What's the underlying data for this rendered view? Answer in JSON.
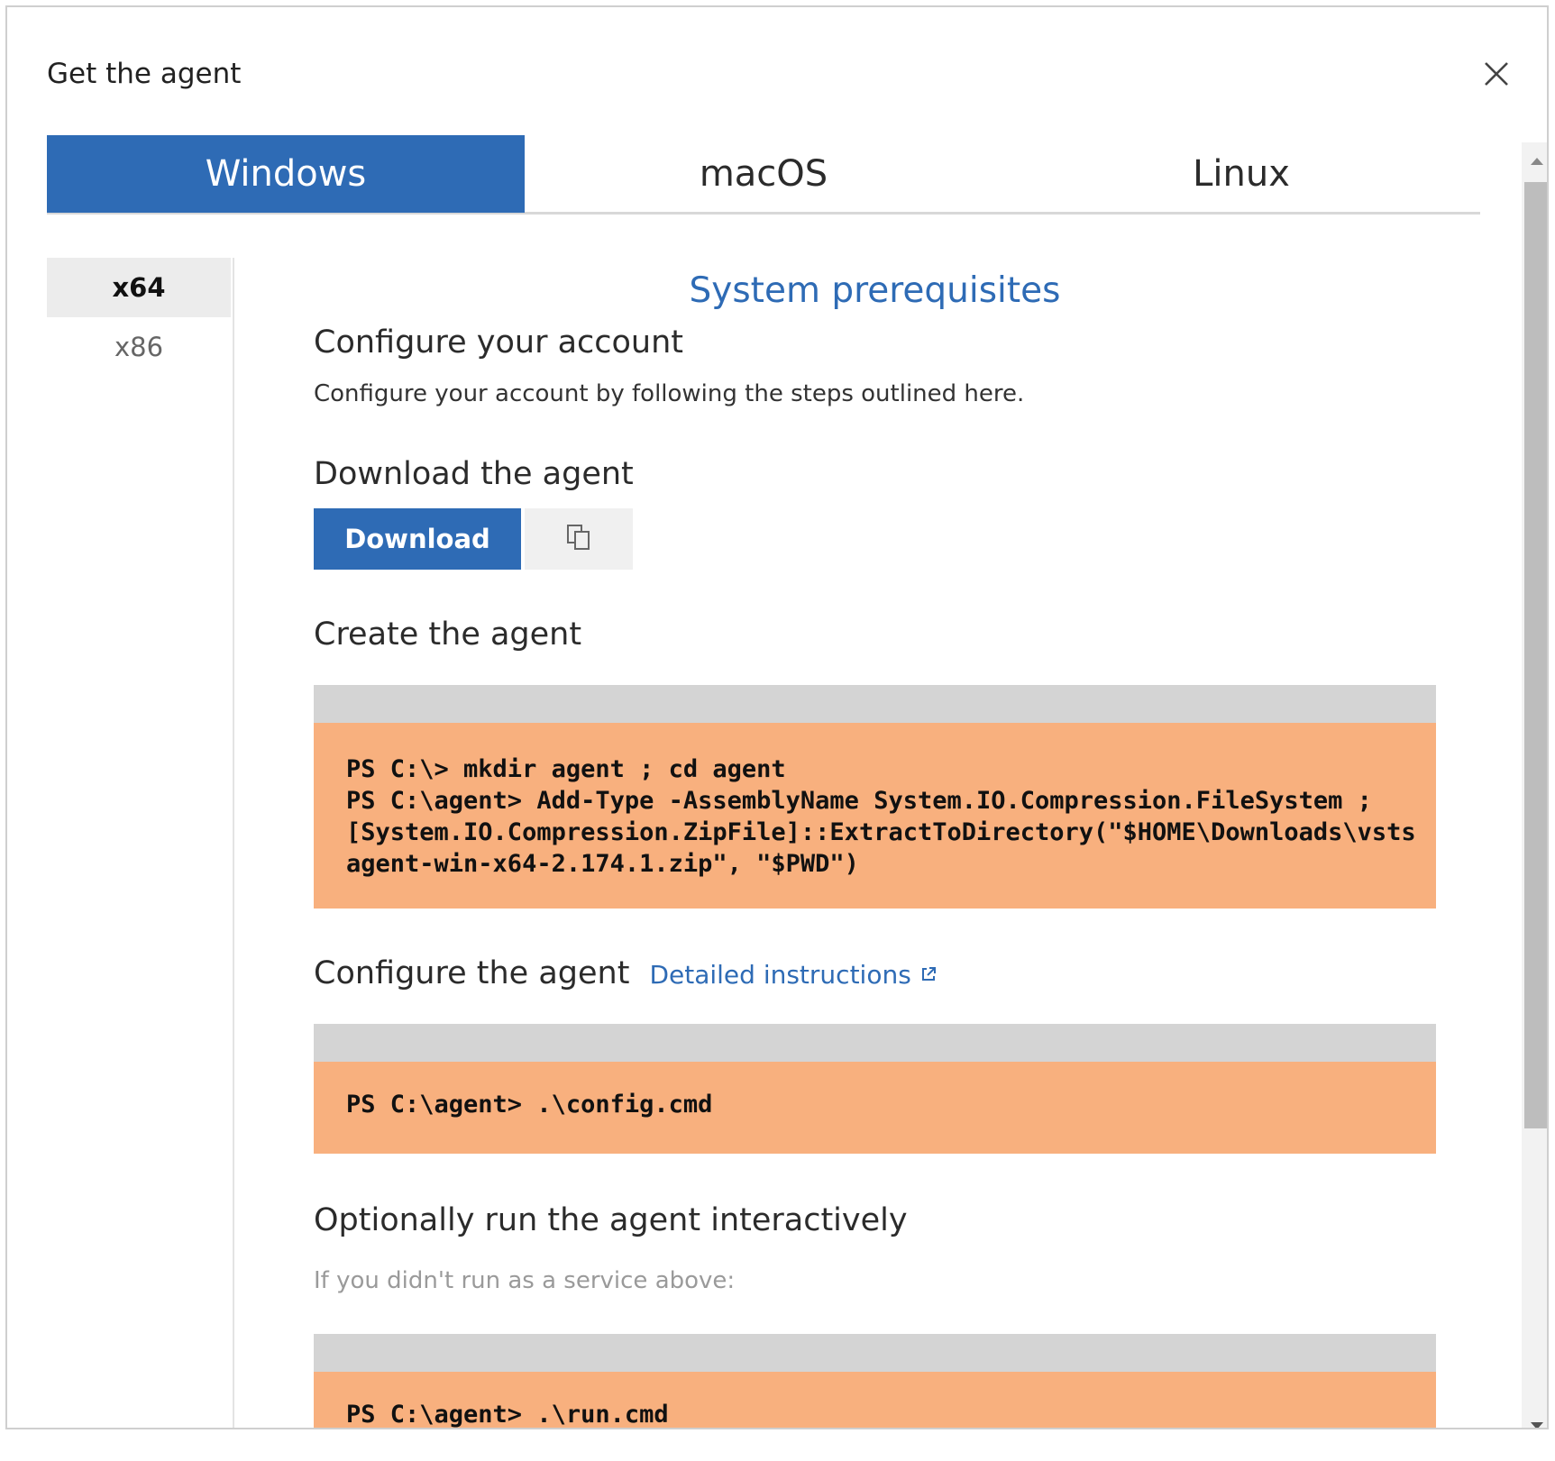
{
  "dialog": {
    "title": "Get the agent"
  },
  "tabs": [
    {
      "label": "Windows",
      "active": true
    },
    {
      "label": "macOS",
      "active": false
    },
    {
      "label": "Linux",
      "active": false
    }
  ],
  "arch": [
    {
      "label": "x64",
      "active": true
    },
    {
      "label": "x86",
      "active": false
    }
  ],
  "content": {
    "sysreq_link": "System prerequisites",
    "configure_account": {
      "heading": "Configure your account",
      "text": "Configure your account by following the steps outlined here."
    },
    "download": {
      "heading": "Download the agent",
      "button_label": "Download",
      "copy_icon": "copy-icon"
    },
    "create": {
      "heading": "Create the agent",
      "code": "PS C:\\> mkdir agent ; cd agent\nPS C:\\agent> Add-Type -AssemblyName System.IO.Compression.FileSystem ;\n[System.IO.Compression.ZipFile]::ExtractToDirectory(\"$HOME\\Downloads\\vsts\nagent-win-x64-2.174.1.zip\", \"$PWD\")"
    },
    "configure_agent": {
      "heading": "Configure the agent",
      "link": "Detailed instructions",
      "code": "PS C:\\agent> .\\config.cmd"
    },
    "run": {
      "heading": "Optionally run the agent interactively",
      "text": "If you didn't run as a service above:",
      "code": "PS C:\\agent> .\\run.cmd"
    }
  },
  "colors": {
    "accent": "#2e6bb5",
    "code_bg": "#f8b07e",
    "code_header": "#d4d4d4"
  }
}
